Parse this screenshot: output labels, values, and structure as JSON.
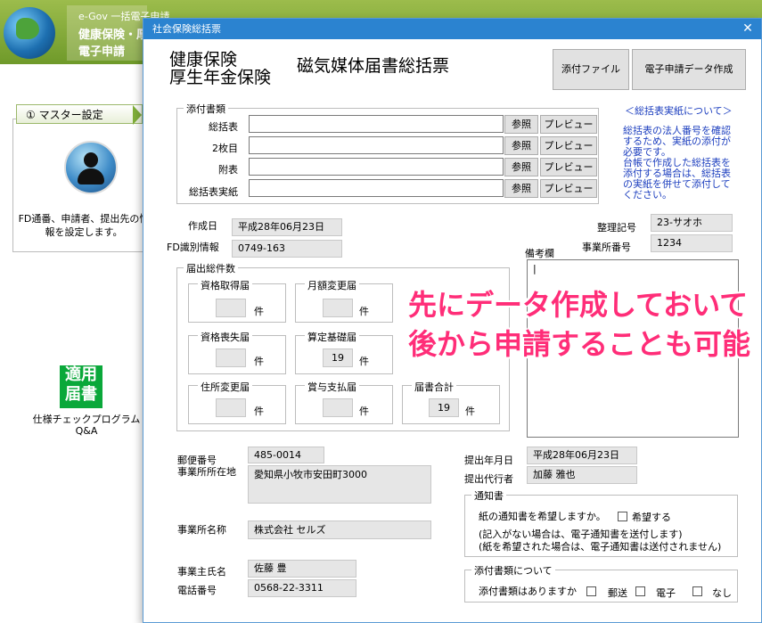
{
  "app": {
    "header_line1": "e-Gov 一括電子申請",
    "header_line2": "健康保険・厚",
    "header_line3": "電子申請",
    "master_tab": "① マスター設定",
    "master_desc": "FD通番、申請者、提出先の情報を設定します。",
    "spec_icon_text_1": "適用",
    "spec_icon_text_2": "届書",
    "spec_label": "仕様チェックプログラム",
    "spec_qa": "Q&A"
  },
  "dialog": {
    "title": "社会保険総括票",
    "heading_line1": "健康保険",
    "heading_line2": "厚生年金保険",
    "heading_right": "磁気媒体届書総括票",
    "attach_file_button": "添付ファイル",
    "create_data_button": "電子申請データ作成",
    "attachments": {
      "group_label": "添付書類",
      "rows": [
        {
          "label": "総括表",
          "value": ""
        },
        {
          "label": "2枚目",
          "value": ""
        },
        {
          "label": "附表",
          "value": ""
        },
        {
          "label": "総括表実紙",
          "value": ""
        }
      ],
      "browse_label": "参照",
      "preview_label": "プレビュー"
    },
    "info": {
      "title": "＜総括表実紙について＞",
      "line1": "総括表の法人番号を確認",
      "line2": "するため、実紙の添付が",
      "line3": "必要です。",
      "line4": "台帳で作成した総括表を",
      "line5": "添付する場合は、総括表",
      "line6": "の実紙を併せて添付して",
      "line7": "ください。"
    },
    "created_date_label": "作成日",
    "created_date": "平成28年06月23日",
    "fd_label": "FD識別情報",
    "fd_value": "0749-163",
    "ref_no_label": "整理記号",
    "ref_no": "23-サオホ",
    "office_no_label": "事業所番号",
    "office_no": "1234",
    "remarks_label": "備考欄",
    "remarks_value": "|",
    "counts": {
      "group_label": "届出総件数",
      "unit": "件",
      "items": [
        {
          "label": "資格取得届",
          "value": ""
        },
        {
          "label": "月額変更届",
          "value": ""
        },
        {
          "label": "資格喪失届",
          "value": ""
        },
        {
          "label": "算定基礎届",
          "value": "19"
        },
        {
          "label": "住所変更届",
          "value": ""
        },
        {
          "label": "賞与支払届",
          "value": ""
        },
        {
          "label": "届書合計",
          "value": "19"
        }
      ]
    },
    "postal_label": "郵便番号",
    "postal": "485-0014",
    "address_label": "事業所所在地",
    "address": "愛知県小牧市安田町3000",
    "office_name_label": "事業所名称",
    "office_name": "株式会社 セルズ",
    "owner_label": "事業主氏名",
    "owner": "佐藤 豊",
    "phone_label": "電話番号",
    "phone": "0568-22-3311",
    "submit_date_label": "提出年月日",
    "submit_date": "平成28年06月23日",
    "agent_label": "提出代行者",
    "agent": "加藤 雅也",
    "notice": {
      "group_label": "通知書",
      "question": "紙の通知書を希望しますか。",
      "checkbox_label": "希望する",
      "note1": "(記入がない場合は、電子通知書を送付します)",
      "note2": "(紙を希望された場合は、電子通知書は送付されません)"
    },
    "attach_type": {
      "group_label": "添付書類について",
      "question": "添付書類はありますか",
      "opt_mail": "郵送",
      "opt_electronic": "電子",
      "opt_none": "なし"
    }
  },
  "overlay": {
    "line1": "先にデータ作成しておいて",
    "line2": "後から申請することも可能"
  }
}
